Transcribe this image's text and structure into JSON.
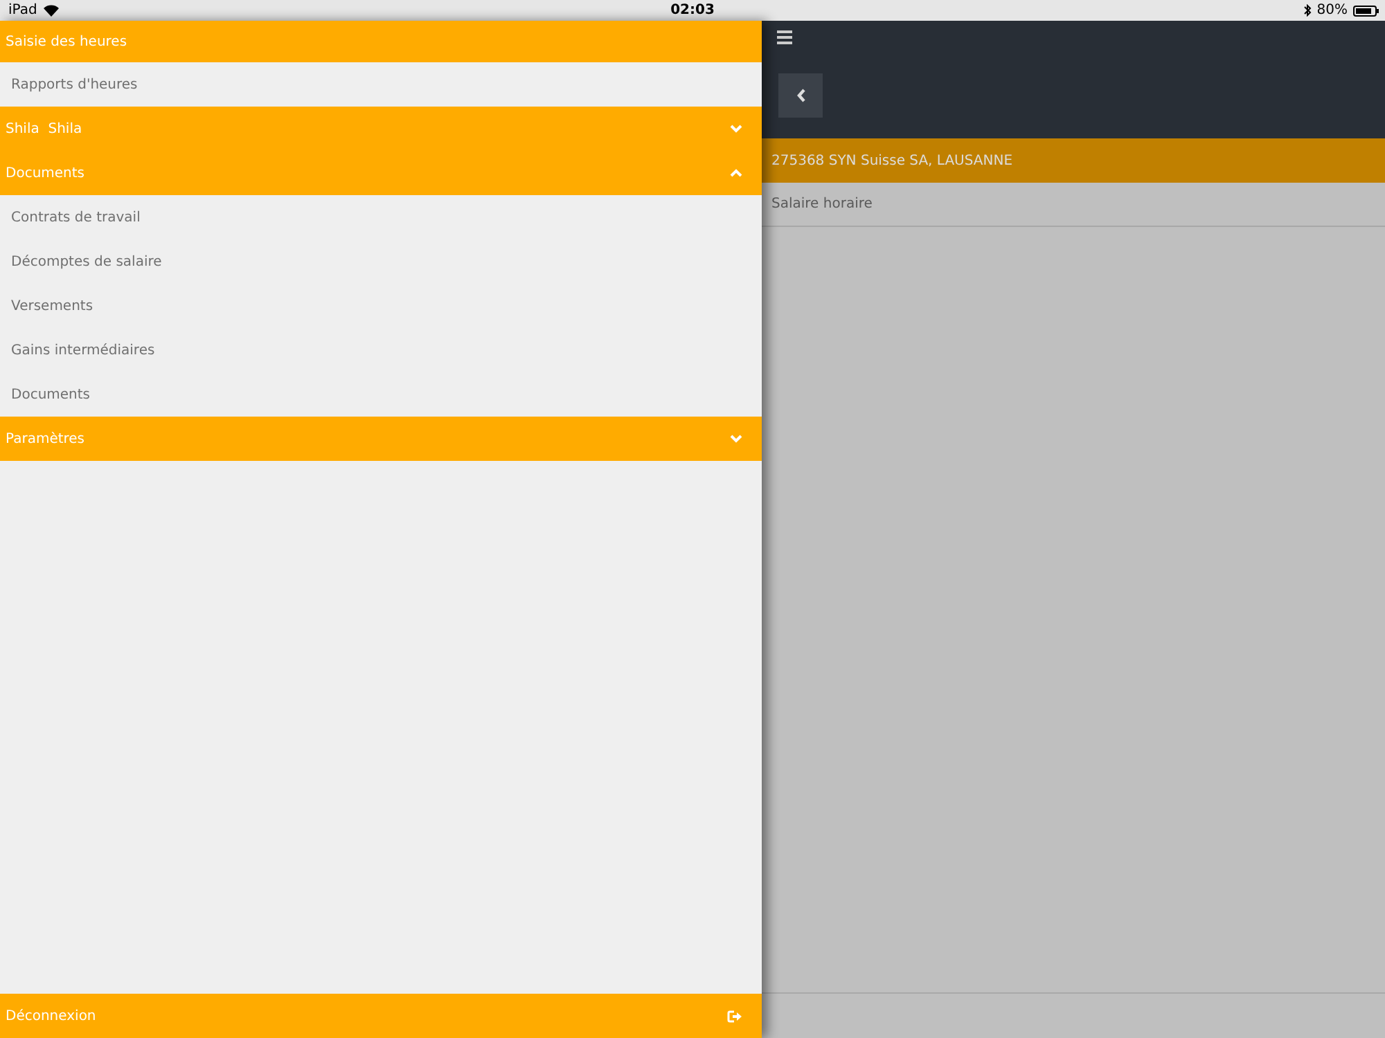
{
  "status_bar": {
    "device": "iPad",
    "time": "02:03",
    "battery": "80%"
  },
  "menu": [
    {
      "label": "Saisie des heures",
      "items": [
        "Rapports d'heures"
      ]
    },
    {
      "label": "Shila  Shila",
      "expanded": false
    },
    {
      "label": "Documents",
      "expanded": true,
      "items": [
        "Contrats de travail",
        "Décomptes de salaire",
        "Versements",
        "Gains intermédiaires",
        "Documents"
      ]
    },
    {
      "label": "Paramètres",
      "expanded": false
    }
  ],
  "logout": {
    "label": "Déconnexion"
  },
  "content": {
    "company": "275368 SYN Suisse SA, LAUSANNE",
    "rows": [
      "Salaire horaire"
    ]
  }
}
